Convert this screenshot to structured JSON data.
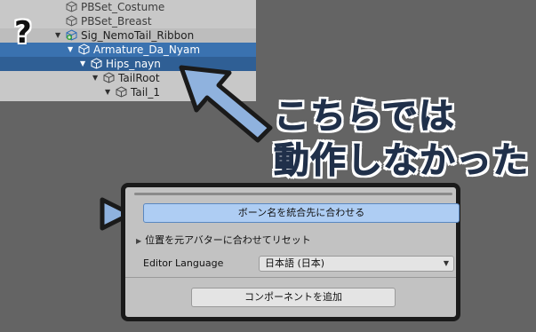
{
  "hierarchy": {
    "rows": [
      {
        "label": "PBSet_Costume"
      },
      {
        "label": "PBSet_Breast"
      },
      {
        "label": "Sig_NemoTail_Ribbon"
      },
      {
        "label": "Armature_Da_Nyam"
      },
      {
        "label": "Hips_nayn"
      },
      {
        "label": "TailRoot"
      },
      {
        "label": "Tail_1"
      }
    ],
    "question_mark": "?"
  },
  "caption": {
    "line1": "こちらでは",
    "line2": "動作しなかった"
  },
  "inspector": {
    "merge_button": "ボーン名を統合先に合わせる",
    "reset_label": "位置を元アバターに合わせてリセット",
    "language_label": "Editor Language",
    "language_value": "日本語 (日本)",
    "add_component_button": "コンポーネントを追加"
  },
  "colors": {
    "selection": "#3a72b0",
    "arrow_fill": "#8fb2de",
    "caption_text": "#20304a",
    "merge_button": "#aecdf3"
  }
}
